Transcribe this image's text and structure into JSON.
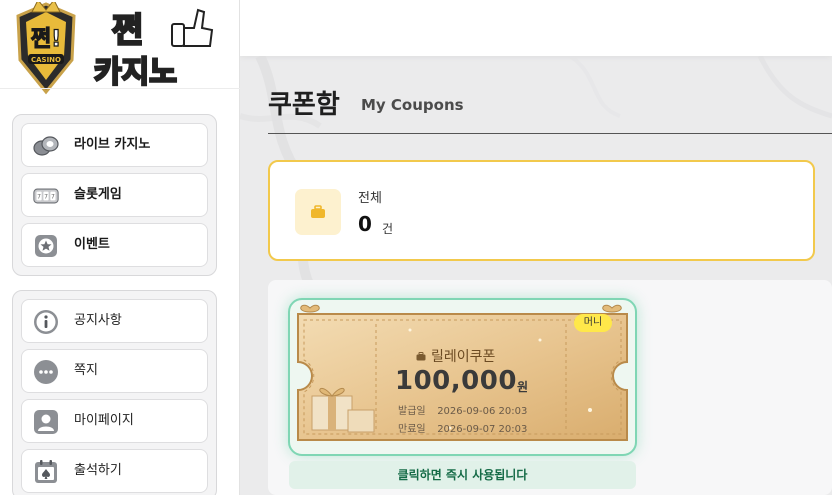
{
  "brand": {
    "logo_main": "쩐!",
    "logo_casino": "CASINO",
    "logo_side_top": "쩐",
    "logo_side_bottom": "카지노"
  },
  "sidebar": {
    "group1": [
      {
        "label": "라이브 카지노",
        "icon": "chips-icon"
      },
      {
        "label": "슬롯게임",
        "icon": "slot-machine-icon"
      },
      {
        "label": "이벤트",
        "icon": "star-badge-icon"
      }
    ],
    "group2": [
      {
        "label": "공지사항",
        "icon": "info-icon"
      },
      {
        "label": "쪽지",
        "icon": "message-icon"
      },
      {
        "label": "마이페이지",
        "icon": "user-icon"
      },
      {
        "label": "출석하기",
        "icon": "calendar-icon"
      }
    ]
  },
  "page": {
    "title": "쿠폰함",
    "subtitle": "My Coupons"
  },
  "summary": {
    "label": "전체",
    "count": "0",
    "unit": "건",
    "icon": "briefcase-icon"
  },
  "coupons": [
    {
      "badge": "머니",
      "name": "릴레이쿠폰",
      "amount": "100,000",
      "currency": "원",
      "issued_label": "발급일",
      "issued_at": "2026-09-06 20:03",
      "expires_label": "만료일",
      "expires_at": "2026-09-07 20:03",
      "action": "클릭하면 즉시 사용됩니다"
    }
  ],
  "colors": {
    "accent": "#f2c94c",
    "coupon_border": "#7fd6b4",
    "action_text": "#156b47"
  }
}
